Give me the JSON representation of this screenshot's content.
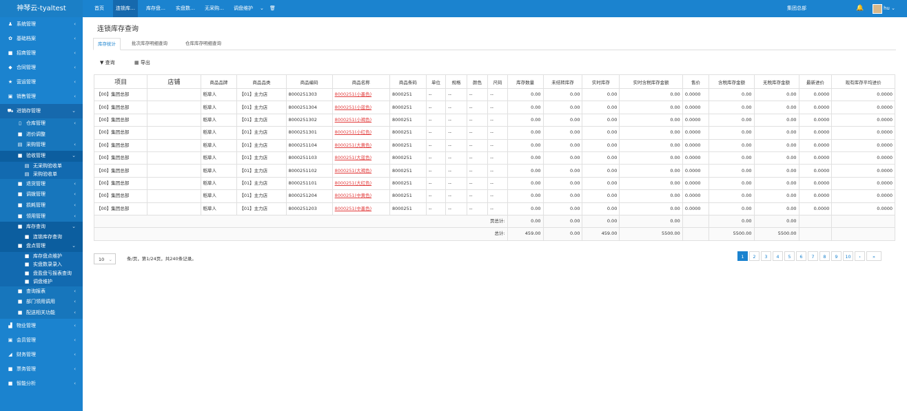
{
  "brand": "神琴云-tyaltest",
  "sidebar": {
    "items": [
      {
        "icon": "user-icon",
        "glyph": "♟",
        "label": "系统管理"
      },
      {
        "icon": "gear-icon",
        "glyph": "✿",
        "label": "基础档案"
      },
      {
        "icon": "grid-icon",
        "glyph": "■",
        "label": "招商管理"
      },
      {
        "icon": "tag-icon",
        "glyph": "◆",
        "label": "合同管理"
      },
      {
        "icon": "star-icon",
        "glyph": "★",
        "label": "营运管理"
      },
      {
        "icon": "calc-icon",
        "glyph": "▣",
        "label": "销售管理"
      },
      {
        "icon": "truck-icon",
        "glyph": "⛟",
        "label": "进销存管理"
      }
    ],
    "jxc_children": [
      {
        "icon": "trash-icon",
        "glyph": "▯",
        "label": "仓库管理"
      },
      {
        "icon": "grid-icon",
        "glyph": "■",
        "label": "进价调整"
      },
      {
        "icon": "doc-icon",
        "glyph": "▤",
        "label": "采购管理"
      },
      {
        "icon": "grid-icon",
        "glyph": "■",
        "label": "验收管理"
      }
    ],
    "ys_children": [
      {
        "icon": "doc-icon",
        "glyph": "▤",
        "label": "无采购验收单"
      },
      {
        "icon": "doc-icon",
        "glyph": "▤",
        "label": "采购验收单"
      }
    ],
    "mid_children": [
      {
        "icon": "grid-icon",
        "glyph": "■",
        "label": "退货管理"
      },
      {
        "icon": "grid-icon",
        "glyph": "■",
        "label": "调拨管理"
      },
      {
        "icon": "grid-icon",
        "glyph": "■",
        "label": "损耗管理"
      },
      {
        "icon": "grid-icon",
        "glyph": "■",
        "label": "领用管理"
      },
      {
        "icon": "grid-icon",
        "glyph": "■",
        "label": "库存查询"
      }
    ],
    "kc_children": [
      {
        "icon": "grid-icon",
        "glyph": "■",
        "label": "连锁库存查询"
      }
    ],
    "pd_item": {
      "icon": "grid-icon",
      "glyph": "■",
      "label": "盘点管理"
    },
    "pd_children": [
      {
        "icon": "grid-icon",
        "glyph": "■",
        "label": "库存盘点维护"
      },
      {
        "icon": "grid-icon",
        "glyph": "■",
        "label": "实盘数录录入"
      },
      {
        "icon": "grid-icon",
        "glyph": "■",
        "label": "盘盈盘亏报表查询"
      },
      {
        "icon": "grid-icon",
        "glyph": "■",
        "label": "调盘维护"
      }
    ],
    "tail_children": [
      {
        "icon": "grid-icon",
        "glyph": "■",
        "label": "查询报表"
      },
      {
        "icon": "grid-icon",
        "glyph": "■",
        "label": "部门领用调用"
      },
      {
        "icon": "grid-icon",
        "glyph": "■",
        "label": "配送相关功能"
      }
    ],
    "bottom_items": [
      {
        "icon": "building-icon",
        "glyph": "▟",
        "label": "物业管理"
      },
      {
        "icon": "card-icon",
        "glyph": "▣",
        "label": "会员管理"
      },
      {
        "icon": "chart-icon",
        "glyph": "◢",
        "label": "财务管理"
      },
      {
        "icon": "grid-icon",
        "glyph": "■",
        "label": "票务管理"
      },
      {
        "icon": "grid-icon",
        "glyph": "■",
        "label": "智能分析"
      }
    ]
  },
  "topbar": {
    "tabs": [
      "首页",
      "连锁库…",
      "库存盘…",
      "实盘数…",
      "无采购…",
      "调盘维护"
    ],
    "more": "⌄",
    "org": "集团总部",
    "user": "hu ⌄"
  },
  "page_title": "连锁库存查询",
  "subtabs": [
    "库存统计",
    "批次库存明细查询",
    "仓库库存明细查询"
  ],
  "toolbar": {
    "query": "查询",
    "export": "导出",
    "query_icon": "▼",
    "export_icon": "▦"
  },
  "table": {
    "headers": [
      "项目",
      "店铺",
      "商品品牌",
      "商品品类",
      "商品编码",
      "商品名称",
      "商品条码",
      "单位",
      "规格",
      "颜色",
      "尺码",
      "库存数量",
      "未结转库存",
      "实时库存",
      "实时含税库存金额",
      "售价",
      "含税库存金额",
      "无税库存金额",
      "最新进价",
      "现有库存平均进价"
    ],
    "rows": [
      [
        "【00】集团总部",
        "",
        "稻草人",
        "【01】主力店",
        "8000251303",
        "8000251(小墨色)",
        "8000251",
        "--",
        "--",
        "--",
        "--",
        "0.00",
        "0.00",
        "0.00",
        "0.00",
        "0.0000",
        "0.00",
        "0.00",
        "0.0000",
        "0.0000"
      ],
      [
        "【00】集团总部",
        "",
        "稻草人",
        "【01】主力店",
        "8000251304",
        "8000251(小蓝色)",
        "8000251",
        "--",
        "--",
        "--",
        "--",
        "0.00",
        "0.00",
        "0.00",
        "0.00",
        "0.0000",
        "0.00",
        "0.00",
        "0.0000",
        "0.0000"
      ],
      [
        "【00】集团总部",
        "",
        "稻草人",
        "【01】主力店",
        "8000251302",
        "8000251(小褐色)",
        "8000251",
        "--",
        "--",
        "--",
        "--",
        "0.00",
        "0.00",
        "0.00",
        "0.00",
        "0.0000",
        "0.00",
        "0.00",
        "0.0000",
        "0.0000"
      ],
      [
        "【00】集团总部",
        "",
        "稻草人",
        "【01】主力店",
        "8000251301",
        "8000251(小红色)",
        "8000251",
        "--",
        "--",
        "--",
        "--",
        "0.00",
        "0.00",
        "0.00",
        "0.00",
        "0.0000",
        "0.00",
        "0.00",
        "0.0000",
        "0.0000"
      ],
      [
        "【00】集团总部",
        "",
        "稻草人",
        "【01】主力店",
        "8000251104",
        "8000251(大黄色)",
        "8000251",
        "--",
        "--",
        "--",
        "--",
        "0.00",
        "0.00",
        "0.00",
        "0.00",
        "0.0000",
        "0.00",
        "0.00",
        "0.0000",
        "0.0000"
      ],
      [
        "【00】集团总部",
        "",
        "稻草人",
        "【01】主力店",
        "8000251103",
        "8000251(大蓝色)",
        "8000251",
        "--",
        "--",
        "--",
        "--",
        "0.00",
        "0.00",
        "0.00",
        "0.00",
        "0.0000",
        "0.00",
        "0.00",
        "0.0000",
        "0.0000"
      ],
      [
        "【00】集团总部",
        "",
        "稻草人",
        "【01】主力店",
        "8000251102",
        "8000251(大褐色)",
        "8000251",
        "--",
        "--",
        "--",
        "--",
        "0.00",
        "0.00",
        "0.00",
        "0.00",
        "0.0000",
        "0.00",
        "0.00",
        "0.0000",
        "0.0000"
      ],
      [
        "【00】集团总部",
        "",
        "稻草人",
        "【01】主力店",
        "8000251101",
        "8000251(大红色)",
        "8000251",
        "--",
        "--",
        "--",
        "--",
        "0.00",
        "0.00",
        "0.00",
        "0.00",
        "0.0000",
        "0.00",
        "0.00",
        "0.0000",
        "0.0000"
      ],
      [
        "【00】集团总部",
        "",
        "稻草人",
        "【01】主力店",
        "8000251204",
        "8000251(中黄色)",
        "8000251",
        "--",
        "--",
        "--",
        "--",
        "0.00",
        "0.00",
        "0.00",
        "0.00",
        "0.0000",
        "0.00",
        "0.00",
        "0.0000",
        "0.0000"
      ],
      [
        "【00】集团总部",
        "",
        "稻草人",
        "【01】主力店",
        "8000251203",
        "8000251(中墨色)",
        "8000251",
        "--",
        "--",
        "--",
        "--",
        "0.00",
        "0.00",
        "0.00",
        "0.00",
        "0.0000",
        "0.00",
        "0.00",
        "0.0000",
        "0.0000"
      ]
    ],
    "page_total": {
      "label": "页总计:",
      "vals": [
        "0.00",
        "0.00",
        "0.00",
        "0.00",
        "",
        "0.00",
        "0.00",
        "",
        ""
      ]
    },
    "grand_total": {
      "label": "总计:",
      "vals": [
        "459.00",
        "0.00",
        "459.00",
        "5500.00",
        "",
        "5500.00",
        "5500.00",
        "",
        ""
      ]
    }
  },
  "pager": {
    "page_size": "10",
    "summary": "条/页，第1/24页，共240条记录。",
    "pages": [
      "1",
      "2",
      "3",
      "4",
      "5",
      "6",
      "7",
      "8",
      "9",
      "10",
      "›",
      "»"
    ]
  },
  "colors": {
    "primary": "#1b83cf",
    "link": "#e23c3c"
  }
}
